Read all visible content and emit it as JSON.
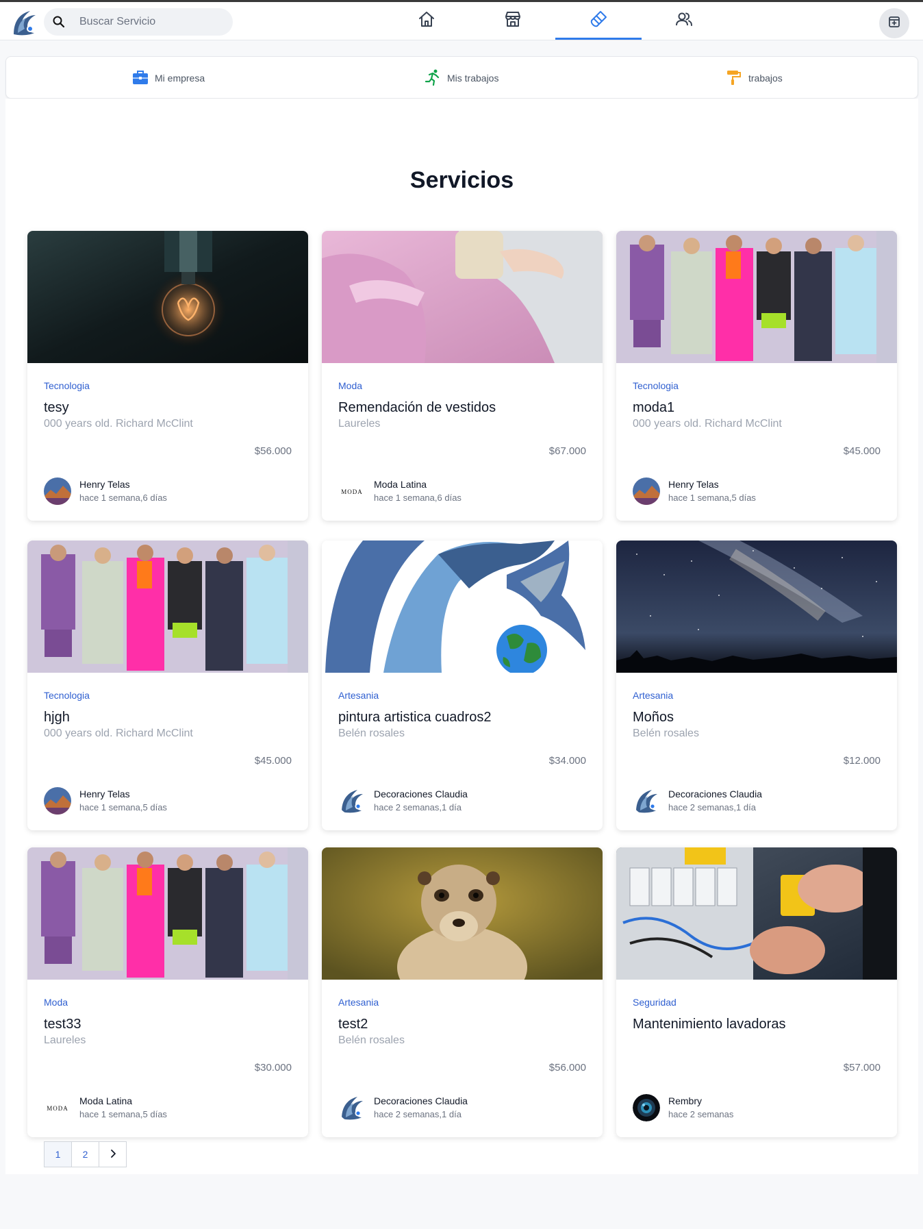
{
  "search": {
    "placeholder": "Buscar Servicio"
  },
  "nav": {
    "tabs": [
      "home",
      "store",
      "services",
      "users"
    ],
    "active": "services"
  },
  "subnav": [
    {
      "label": "Mi empresa",
      "icon": "briefcase-icon",
      "color": "#2f7bea"
    },
    {
      "label": "Mis trabajos",
      "icon": "running-person-icon",
      "color": "#10a34a"
    },
    {
      "label": "trabajos",
      "icon": "paint-roller-icon",
      "color": "#f5a524"
    }
  ],
  "page": {
    "title": "Servicios"
  },
  "cards": [
    {
      "image": "light-bulb-photo",
      "category": "Tecnologia",
      "name": "tesy",
      "location": "000 years old. Richard McClint",
      "price": "$56.000",
      "author": "Henry Telas",
      "time": "hace 1 semana,6 días",
      "avatar": "landscape-avatar"
    },
    {
      "image": "pink-dress-photo",
      "category": "Moda",
      "name": "Remendación de vestidos",
      "location": "Laureles",
      "price": "$67.000",
      "author": "Moda Latina",
      "time": "hace 1 semana,6 días",
      "avatar": "moda-logo",
      "avatar_text": "MODA"
    },
    {
      "image": "fashion-runway-photo",
      "category": "Tecnologia",
      "name": "moda1",
      "location": "000 years old. Richard McClint",
      "price": "$45.000",
      "author": "Henry Telas",
      "time": "hace 1 semana,5 días",
      "avatar": "landscape-avatar"
    },
    {
      "image": "fashion-runway-photo",
      "category": "Tecnologia",
      "name": "hjgh",
      "location": "000 years old. Richard McClint",
      "price": "$45.000",
      "author": "Henry Telas",
      "time": "hace 1 semana,5 días",
      "avatar": "landscape-avatar"
    },
    {
      "image": "dragon-globe-logo",
      "category": "Artesania",
      "name": "pintura artistica cuadros2",
      "location": "Belén rosales",
      "price": "$34.000",
      "author": "Decoraciones Claudia",
      "time": "hace 2 semanas,1 día",
      "avatar": "dragon-logo"
    },
    {
      "image": "night-sky-photo",
      "category": "Artesania",
      "name": "Moños",
      "location": "Belén rosales",
      "price": "$12.000",
      "author": "Decoraciones Claudia",
      "time": "hace 2 semanas,1 día",
      "avatar": "dragon-logo"
    },
    {
      "image": "fashion-runway-photo",
      "category": "Moda",
      "name": "test33",
      "location": "Laureles",
      "price": "$30.000",
      "author": "Moda Latina",
      "time": "hace 1 semana,5 días",
      "avatar": "moda-logo",
      "avatar_text": "MODA"
    },
    {
      "image": "meerkat-photo",
      "category": "Artesania",
      "name": "test2",
      "location": "Belén rosales",
      "price": "$56.000",
      "author": "Decoraciones Claudia",
      "time": "hace 2 semanas,1 día",
      "avatar": "dragon-logo"
    },
    {
      "image": "electrical-panel-photo",
      "category": "Seguridad",
      "name": "Mantenimiento lavadoras",
      "location": "",
      "price": "$57.000",
      "author": "Rembry",
      "time": "hace 2 semanas",
      "avatar": "camera-lens-avatar"
    }
  ],
  "pagination": {
    "pages": [
      "1",
      "2"
    ],
    "current": "1"
  },
  "colors": {
    "accent": "#2f7bea",
    "category": "#2f5fd0"
  }
}
